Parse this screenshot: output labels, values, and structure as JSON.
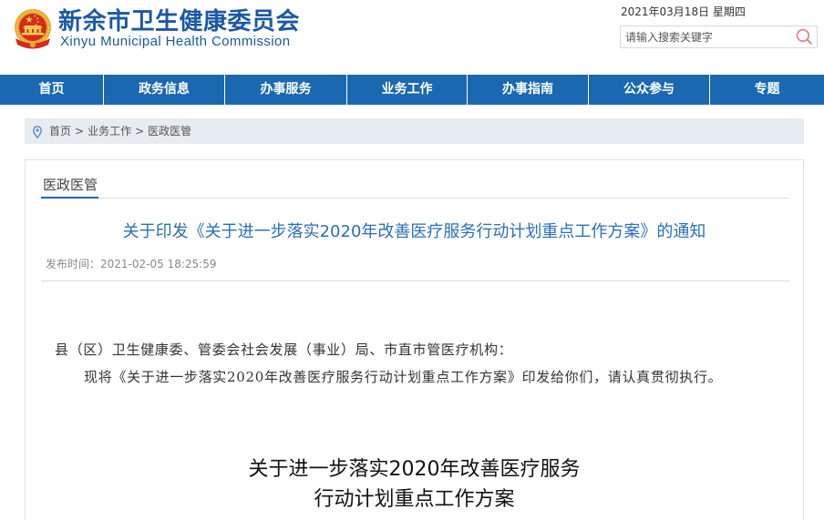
{
  "header": {
    "title": "新余市卫生健康委员会",
    "subtitle": "Xinyu Municipal Health Commission",
    "emblem_icon": "national-emblem-icon",
    "date": "2021年03月18日 星期四",
    "search": {
      "placeholder": "请输入搜索关键字",
      "value": "",
      "icon": "search-icon"
    }
  },
  "nav": {
    "items": [
      {
        "label": "首页"
      },
      {
        "label": "政务信息"
      },
      {
        "label": "办事服务"
      },
      {
        "label": "业务工作"
      },
      {
        "label": "办事指南"
      },
      {
        "label": "公众参与"
      },
      {
        "label": "专题"
      }
    ]
  },
  "breadcrumb": {
    "icon": "location-pin-icon",
    "items": [
      "首页",
      "业务工作",
      "医政医管"
    ],
    "separator": ">"
  },
  "section": {
    "tab_label": "医政医管"
  },
  "article": {
    "title": "关于印发《关于进一步落实2020年改善医疗服务行动计划重点工作方案》的通知",
    "publish_label": "发布时间：",
    "publish_time": "2021-02-05 18:25:59",
    "salutation": "县（区）卫生健康委、管委会社会发展（事业）局、市直市管医疗机构：",
    "body": "现将《关于进一步落实2020年改善医疗服务行动计划重点工作方案》印发给你们，请认真贯彻执行。",
    "document_heading_lines": [
      "关于进一步落实2020年改善医疗服务",
      "行动计划重点工作方案"
    ]
  },
  "colors": {
    "brand_blue": "#1a68b0",
    "logo_blue": "#1b58a6",
    "article_title_blue": "#2a6fb9",
    "breadcrumb_bg": "#e7ecf1",
    "search_icon": "#e27f86",
    "emblem_red": "#d52a20",
    "emblem_gold": "#e4a62b"
  }
}
